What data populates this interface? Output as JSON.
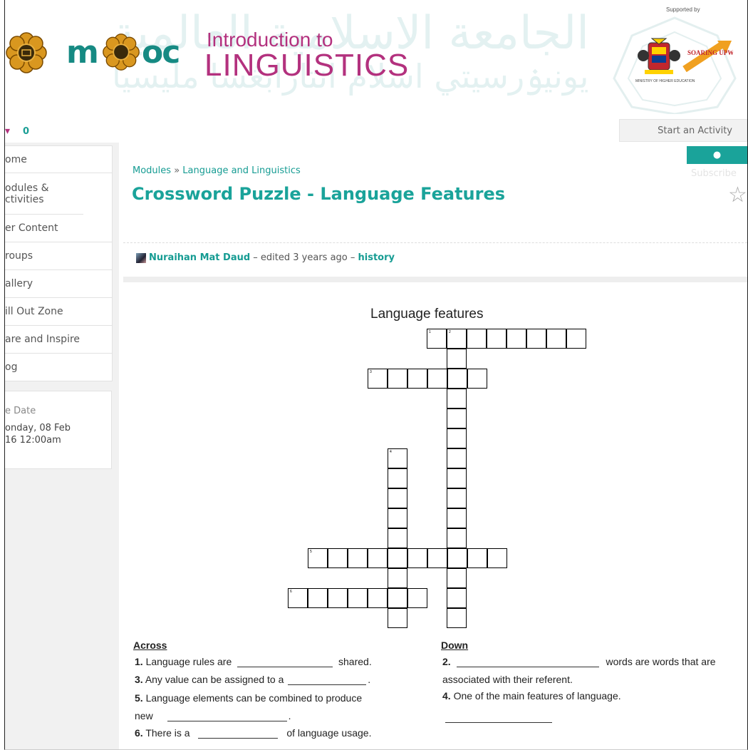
{
  "banner": {
    "logo_text": "m",
    "logo_text2": "oc",
    "title_line1": "Introduction to",
    "title_line2": "LINGUISTICS",
    "supported_by": "Supported by",
    "crest_caption": "MINISTRY OF HIGHER EDUCATION",
    "partner_name": "SOARING UPWARDS",
    "arabic_top": "الجامعة الاسلامية العالمية",
    "arabic_bottom": "يونيۏرسيتي اسلام انتارابڠسا مليسيا"
  },
  "topbar": {
    "counter_value": "0",
    "start_activity": "Start an Activity"
  },
  "sidebar": {
    "items": [
      {
        "label": "ome"
      },
      {
        "label": "odules & ctivities"
      },
      {
        "label": "er Content"
      },
      {
        "label": "roups"
      },
      {
        "label": "allery"
      },
      {
        "label": "ill Out Zone"
      },
      {
        "label": "are and Inspire"
      },
      {
        "label": "og"
      }
    ],
    "date_label": "e Date",
    "date_line1": "onday, 08 Feb",
    "date_line2": "16 12:00am"
  },
  "page": {
    "breadcrumb_root": "Modules",
    "breadcrumb_sep": "»",
    "breadcrumb_current": "Language and Linguistics",
    "title": "Crossword Puzzle - Language Features",
    "subscribe": "Subscribe",
    "author": "Nuraihan Mat Daud",
    "edited": " – edited 3 years ago – ",
    "history": "history"
  },
  "puzzle": {
    "title": "Language features",
    "cell_numbers": [
      "1",
      "2",
      "3",
      "4",
      "5",
      "6"
    ],
    "across_heading": "Across",
    "down_heading": "Down",
    "across": [
      {
        "num": "1.",
        "before": "Language rules are",
        "after": "shared."
      },
      {
        "num": "3.",
        "before": "Any value can be assigned to a",
        "after": "."
      },
      {
        "num": "5.",
        "before": "Language elements can be combined to produce",
        "after": "."
      },
      {
        "num": "6.",
        "before": "There is a",
        "after": "of language usage."
      }
    ],
    "across_5_cont": "new",
    "down": [
      {
        "num": "2.",
        "after": "words are words that are"
      },
      {
        "num": "4.",
        "text": "One of the main features of language."
      }
    ],
    "down_2_cont": "associated with their referent."
  },
  "colors": {
    "teal": "#1aa39a",
    "magenta": "#b3317e",
    "mooc_green": "#168a83"
  }
}
